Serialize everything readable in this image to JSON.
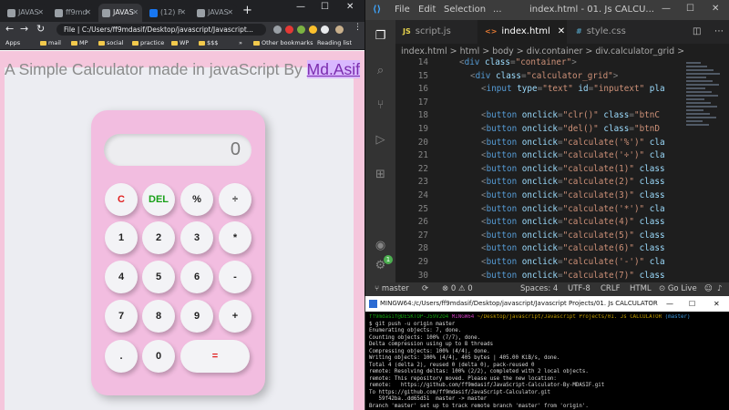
{
  "browser": {
    "tabs": [
      {
        "label": "JAVAS",
        "active": false
      },
      {
        "label": "ff9md",
        "active": false
      },
      {
        "label": "JAVAS",
        "active": true
      },
      {
        "label": "(12) F",
        "active": false
      },
      {
        "label": "JAVAS",
        "active": false
      }
    ],
    "address": "File | C:/Users/ff9mdasif/Desktop/javascript/Javascript...",
    "bookmarks": [
      "Apps",
      "mail",
      "MP",
      "social",
      "practice",
      "WP",
      "$$$",
      "»",
      "Other bookmarks",
      "Reading list"
    ]
  },
  "page": {
    "title": "A Simple Calculator made in javaScript By ",
    "author": "Md.Asif"
  },
  "calculator": {
    "display_value": "0",
    "keys": [
      "C",
      "DEL",
      "%",
      "÷",
      "1",
      "2",
      "3",
      "*",
      "4",
      "5",
      "6",
      "-",
      "7",
      "8",
      "9",
      "+",
      ".",
      "0",
      "="
    ]
  },
  "vscode": {
    "menu": [
      "File",
      "Edit",
      "Selection",
      "..."
    ],
    "window_title": "index.html - 01. Js CALCU...",
    "tabs": [
      {
        "label": "script.js",
        "icon": "JS",
        "active": false
      },
      {
        "label": "index.html",
        "icon": "<>",
        "active": true
      },
      {
        "label": "style.css",
        "icon": "#",
        "active": false
      }
    ],
    "breadcrumb": "index.html > html > body > div.container > div.calculator_grid >",
    "code_lines": [
      {
        "n": "14",
        "indent": 2,
        "parts": [
          [
            "pun",
            "<"
          ],
          [
            "tag",
            "div"
          ],
          [
            "attr",
            " class"
          ],
          [
            "pun",
            "="
          ],
          [
            "str",
            "\"container\""
          ],
          [
            "pun",
            ">"
          ]
        ]
      },
      {
        "n": "15",
        "indent": 3,
        "parts": [
          [
            "pun",
            "<"
          ],
          [
            "tag",
            "div"
          ],
          [
            "attr",
            " class"
          ],
          [
            "pun",
            "="
          ],
          [
            "str",
            "\"calculator_grid\""
          ],
          [
            "pun",
            ">"
          ]
        ]
      },
      {
        "n": "16",
        "indent": 4,
        "parts": [
          [
            "pun",
            "<"
          ],
          [
            "tag",
            "input"
          ],
          [
            "attr",
            " type"
          ],
          [
            "pun",
            "="
          ],
          [
            "str",
            "\"text\""
          ],
          [
            "attr",
            " id"
          ],
          [
            "pun",
            "="
          ],
          [
            "str",
            "\"inputext\""
          ],
          [
            "attr",
            " pla"
          ]
        ]
      },
      {
        "n": "17",
        "indent": 0,
        "parts": []
      },
      {
        "n": "18",
        "indent": 4,
        "parts": [
          [
            "pun",
            "<"
          ],
          [
            "tag",
            "button"
          ],
          [
            "attr",
            " onclick"
          ],
          [
            "pun",
            "="
          ],
          [
            "str",
            "\"clr()\""
          ],
          [
            "attr",
            " class"
          ],
          [
            "pun",
            "="
          ],
          [
            "str",
            "\"btnC"
          ]
        ]
      },
      {
        "n": "19",
        "indent": 4,
        "parts": [
          [
            "pun",
            "<"
          ],
          [
            "tag",
            "button"
          ],
          [
            "attr",
            " onclick"
          ],
          [
            "pun",
            "="
          ],
          [
            "str",
            "\"del()\""
          ],
          [
            "attr",
            " class"
          ],
          [
            "pun",
            "="
          ],
          [
            "str",
            "\"btnD"
          ]
        ]
      },
      {
        "n": "20",
        "indent": 4,
        "parts": [
          [
            "pun",
            "<"
          ],
          [
            "tag",
            "button"
          ],
          [
            "attr",
            " onclick"
          ],
          [
            "pun",
            "="
          ],
          [
            "str",
            "\"calculate('%')\""
          ],
          [
            "attr",
            " cla"
          ]
        ]
      },
      {
        "n": "21",
        "indent": 4,
        "parts": [
          [
            "pun",
            "<"
          ],
          [
            "tag",
            "button"
          ],
          [
            "attr",
            " onclick"
          ],
          [
            "pun",
            "="
          ],
          [
            "str",
            "\"calculate('÷')\""
          ],
          [
            "attr",
            " cla"
          ]
        ]
      },
      {
        "n": "22",
        "indent": 4,
        "parts": [
          [
            "pun",
            "<"
          ],
          [
            "tag",
            "button"
          ],
          [
            "attr",
            " onclick"
          ],
          [
            "pun",
            "="
          ],
          [
            "str",
            "\"calculate(1)\""
          ],
          [
            "attr",
            " class"
          ]
        ]
      },
      {
        "n": "23",
        "indent": 4,
        "parts": [
          [
            "pun",
            "<"
          ],
          [
            "tag",
            "button"
          ],
          [
            "attr",
            " onclick"
          ],
          [
            "pun",
            "="
          ],
          [
            "str",
            "\"calculate(2)\""
          ],
          [
            "attr",
            " class"
          ]
        ]
      },
      {
        "n": "24",
        "indent": 4,
        "parts": [
          [
            "pun",
            "<"
          ],
          [
            "tag",
            "button"
          ],
          [
            "attr",
            " onclick"
          ],
          [
            "pun",
            "="
          ],
          [
            "str",
            "\"calculate(3)\""
          ],
          [
            "attr",
            " class"
          ]
        ]
      },
      {
        "n": "25",
        "indent": 4,
        "parts": [
          [
            "pun",
            "<"
          ],
          [
            "tag",
            "button"
          ],
          [
            "attr",
            " onclick"
          ],
          [
            "pun",
            "="
          ],
          [
            "str",
            "\"calculate('*')\""
          ],
          [
            "attr",
            " cla"
          ]
        ]
      },
      {
        "n": "26",
        "indent": 4,
        "parts": [
          [
            "pun",
            "<"
          ],
          [
            "tag",
            "button"
          ],
          [
            "attr",
            " onclick"
          ],
          [
            "pun",
            "="
          ],
          [
            "str",
            "\"calculate(4)\""
          ],
          [
            "attr",
            " class"
          ]
        ]
      },
      {
        "n": "27",
        "indent": 4,
        "parts": [
          [
            "pun",
            "<"
          ],
          [
            "tag",
            "button"
          ],
          [
            "attr",
            " onclick"
          ],
          [
            "pun",
            "="
          ],
          [
            "str",
            "\"calculate(5)\""
          ],
          [
            "attr",
            " class"
          ]
        ]
      },
      {
        "n": "28",
        "indent": 4,
        "parts": [
          [
            "pun",
            "<"
          ],
          [
            "tag",
            "button"
          ],
          [
            "attr",
            " onclick"
          ],
          [
            "pun",
            "="
          ],
          [
            "str",
            "\"calculate(6)\""
          ],
          [
            "attr",
            " class"
          ]
        ]
      },
      {
        "n": "29",
        "indent": 4,
        "parts": [
          [
            "pun",
            "<"
          ],
          [
            "tag",
            "button"
          ],
          [
            "attr",
            " onclick"
          ],
          [
            "pun",
            "="
          ],
          [
            "str",
            "\"calculate('-')\""
          ],
          [
            "attr",
            " cla"
          ]
        ]
      },
      {
        "n": "30",
        "indent": 4,
        "parts": [
          [
            "pun",
            "<"
          ],
          [
            "tag",
            "button"
          ],
          [
            "attr",
            " onclick"
          ],
          [
            "pun",
            "="
          ],
          [
            "str",
            "\"calculate(7)\""
          ],
          [
            "attr",
            " class"
          ]
        ]
      },
      {
        "n": "31",
        "indent": 4,
        "parts": [
          [
            "pun",
            "<"
          ],
          [
            "tag",
            "button"
          ],
          [
            "attr",
            " onclick"
          ],
          [
            "pun",
            "="
          ],
          [
            "str",
            "\"calculate(8)\""
          ],
          [
            "attr",
            " class"
          ]
        ]
      }
    ],
    "status": {
      "branch": "master",
      "errors": "0",
      "warnings": "0",
      "spaces": "Spaces: 4",
      "encoding": "UTF-8",
      "eol": "CRLF",
      "language": "HTML",
      "golive": "Go Live"
    }
  },
  "terminal": {
    "title": "MINGW64:/c/Users/ff9mdasif/Desktop/javascript/Javascript Projects/01. Js CALCULATOR",
    "lines": [
      [
        [
          "g",
          "ff9mdasif@DESKTOP-J59V2O4 "
        ],
        [
          "p",
          "MINGW64 "
        ],
        [
          "y",
          "~/Desktop/javascript/Javascript Projects/01. Js CALCULATOR "
        ],
        [
          "c",
          "(master)"
        ]
      ],
      [
        [
          "w",
          "$ git push -u origin master"
        ]
      ],
      [
        [
          "w",
          "Enumerating objects: 7, done."
        ]
      ],
      [
        [
          "w",
          "Counting objects: 100% (7/7), done."
        ]
      ],
      [
        [
          "w",
          "Delta compression using up to 8 threads"
        ]
      ],
      [
        [
          "w",
          "Compressing objects: 100% (4/4), done."
        ]
      ],
      [
        [
          "w",
          "Writing objects: 100% (4/4), 405 bytes | 405.00 KiB/s, done."
        ]
      ],
      [
        [
          "w",
          "Total 4 (delta 2), reused 0 (delta 0), pack-reused 0"
        ]
      ],
      [
        [
          "w",
          "remote: Resolving deltas: 100% (2/2), completed with 2 local objects."
        ]
      ],
      [
        [
          "w",
          "remote: This repository moved. Please use the new location:"
        ]
      ],
      [
        [
          "w",
          "remote:   https://github.com/ff9mdasif/JavaScript-Calculator-By-MDASIF.git"
        ]
      ],
      [
        [
          "w",
          "To https://github.com/ff9mdasif/JavaScript-Calculator.git"
        ]
      ],
      [
        [
          "w",
          "   59f42ba..dd65d51  master -> master"
        ]
      ],
      [
        [
          "w",
          "Branch 'master' set up to track remote branch 'master' from 'origin'."
        ]
      ]
    ]
  }
}
